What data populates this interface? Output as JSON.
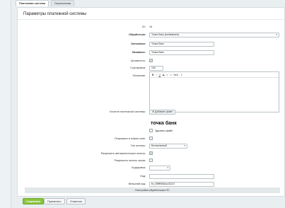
{
  "tabs": [
    "Платежная система",
    "Ограничения"
  ],
  "sidebar": {
    "items": [
      "",
      "",
      "",
      "",
      "",
      "",
      "",
      "",
      ""
    ]
  },
  "panel": {
    "title": "Параметры платежной системы",
    "id_label": "ID:",
    "id_value": "14",
    "handler_label": "Обработчик:",
    "handler_value": "Точка Банк (tochkabank)",
    "title_label": "Заголовок:",
    "title_value": "Точка Банк",
    "name_label": "Название:",
    "name_value": "Точка Банк",
    "active_label": "Активность:",
    "sort_label": "Сортировка:",
    "sort_value": "100",
    "desc_label": "Описание:",
    "editor_toolbar": [
      "B",
      "I",
      "U",
      "S",
      "≡",
      "≡",
      "html",
      "⇧"
    ],
    "logo_label": "Логотип платежной системы:",
    "add_file": "Добавить файл",
    "logo_text": "точка банк",
    "delete_file": "Удалить файл",
    "new_window_label": "Открывать в новом окне:",
    "pay_type_label": "Тип оплаты:",
    "pay_type_value": "Безналичный",
    "auto_pay_label": "Разрешить автоматическую оплату:",
    "print_label": "Разрешить печать чеков:",
    "cashbox_label": "Кодировка:",
    "code_label": "Код:",
    "ext_code_label": "Внешний код:",
    "ext_code_value": "bx_5f9ff0b5a1c31147",
    "settings_section": "Настройка обработчика ПС"
  },
  "buttons": {
    "save": "Сохранить",
    "apply": "Применить",
    "cancel": "Отменить"
  }
}
